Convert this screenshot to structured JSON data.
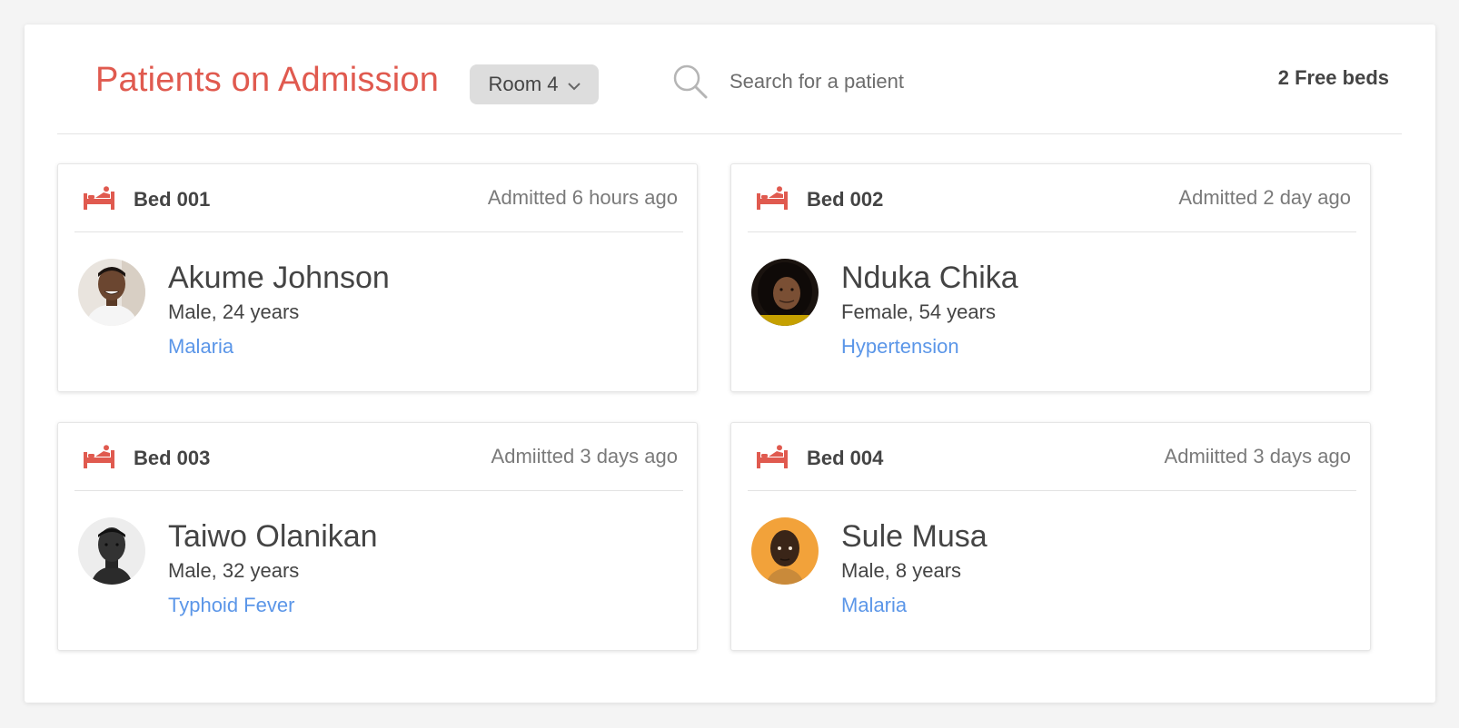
{
  "header": {
    "title": "Patients on Admission",
    "room_select": {
      "selected": "Room 4"
    },
    "search": {
      "placeholder": "Search for a patient",
      "value": ""
    },
    "free_beds": "2 Free beds"
  },
  "colors": {
    "accent": "#e05a4f",
    "link": "#5b96e8",
    "text": "#444444"
  },
  "beds": [
    {
      "bed": "Bed 001",
      "admitted": "Admitted 6 hours ago",
      "name": "Akume Johnson",
      "meta": "Male, 24 years",
      "diagnosis": "Malaria"
    },
    {
      "bed": "Bed 002",
      "admitted": "Admitted 2 day ago",
      "name": "Nduka Chika",
      "meta": "Female, 54 years",
      "diagnosis": "Hypertension"
    },
    {
      "bed": "Bed 003",
      "admitted": "Admiitted 3 days ago",
      "name": "Taiwo Olanikan",
      "meta": "Male, 32 years",
      "diagnosis": "Typhoid Fever"
    },
    {
      "bed": "Bed 004",
      "admitted": "Admiitted 3 days ago",
      "name": "Sule Musa",
      "meta": "Male, 8 years",
      "diagnosis": "Malaria"
    }
  ]
}
